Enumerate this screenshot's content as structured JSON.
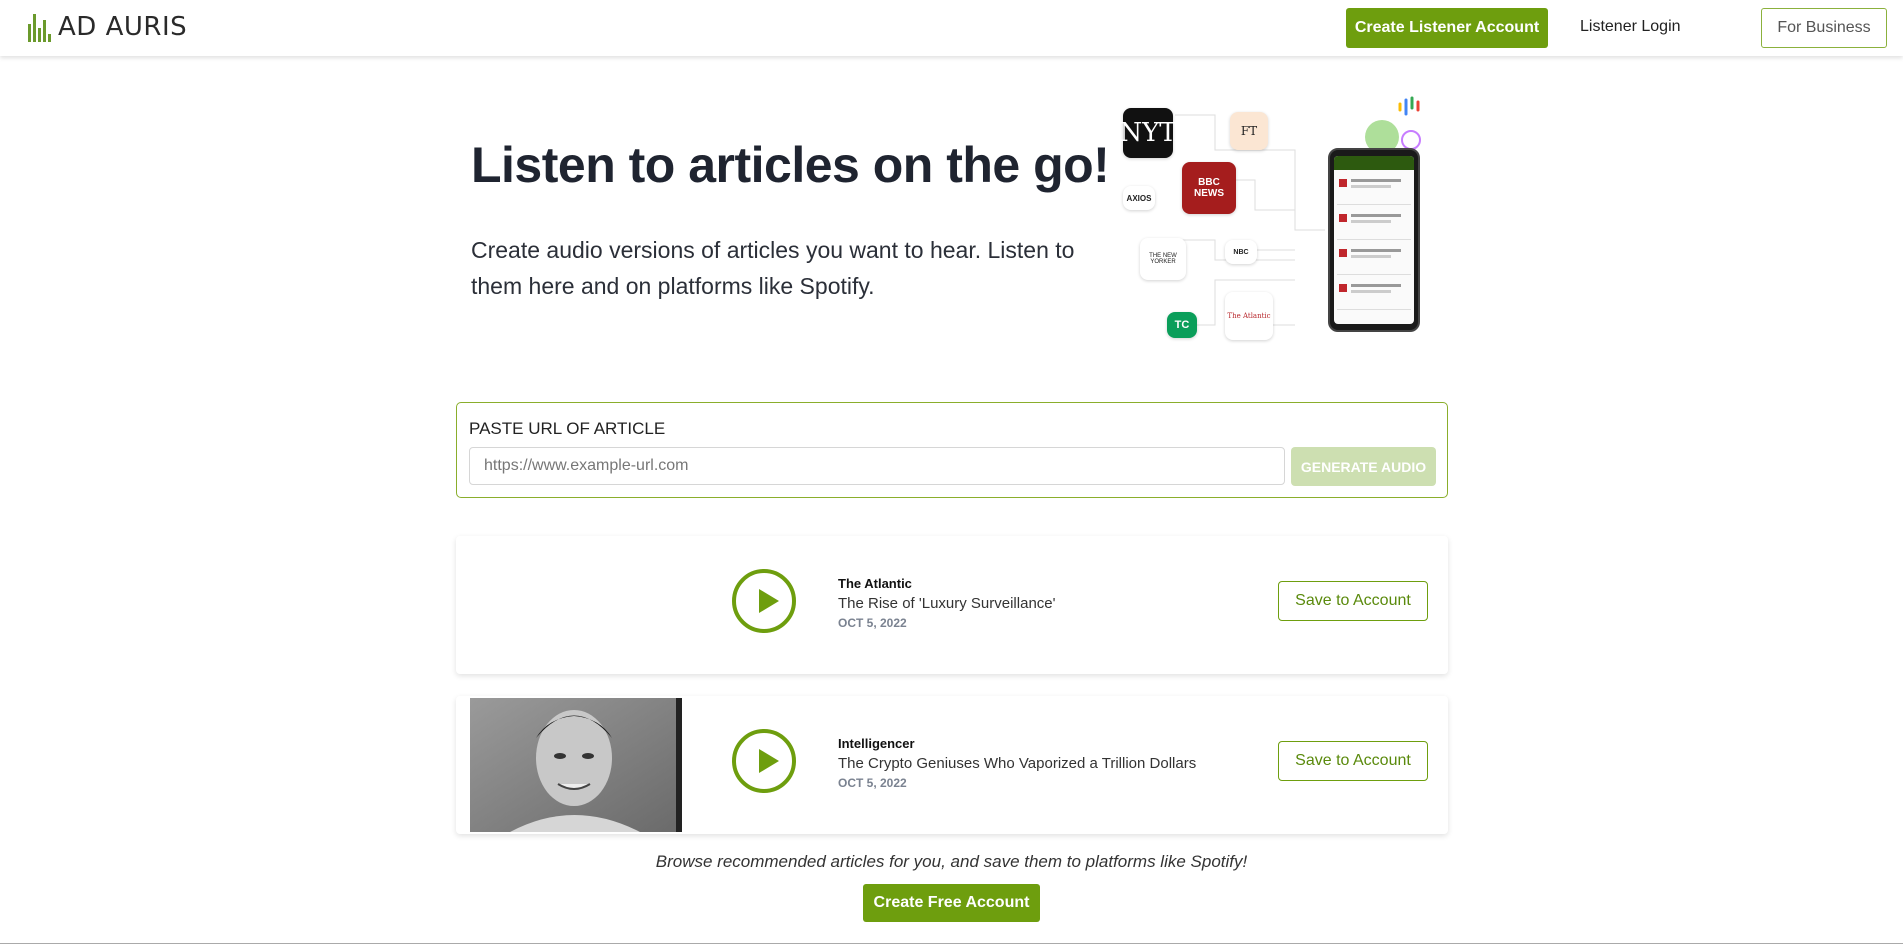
{
  "header": {
    "logo_text": "AD AURIS",
    "create_listener_label": "Create Listener Account",
    "login_label": "Listener Login",
    "business_label": "For Business"
  },
  "hero": {
    "title": "Listen to articles on the go!",
    "subtitle": "Create audio versions of articles you want to hear. Listen to them here and on platforms like Spotify."
  },
  "illustration": {
    "logos": [
      "NYT",
      "FT",
      "AXIOS",
      "BBC NEWS",
      "THE NEW YORKER",
      "NBC",
      "TC",
      "The Atlantic"
    ]
  },
  "url_form": {
    "label": "PASTE URL OF ARTICLE",
    "placeholder": "https://www.example-url.com",
    "generate_label": "GENERATE AUDIO"
  },
  "articles": [
    {
      "publication": "The Atlantic",
      "title": "The Rise of 'Luxury Surveillance'",
      "date": "OCT 5, 2022",
      "save_label": "Save to Account"
    },
    {
      "publication": "Intelligencer",
      "title": "The Crypto Geniuses Who Vaporized a Trillion Dollars",
      "date": "OCT 5, 2022",
      "save_label": "Save to Account"
    }
  ],
  "footer": {
    "browse_text": "Browse recommended articles for you, and save them to platforms like Spotify!",
    "create_free_label": "Create Free Account"
  },
  "colors": {
    "brand_green": "#6e9e0e",
    "generate_disabled": "#cddfb1"
  }
}
